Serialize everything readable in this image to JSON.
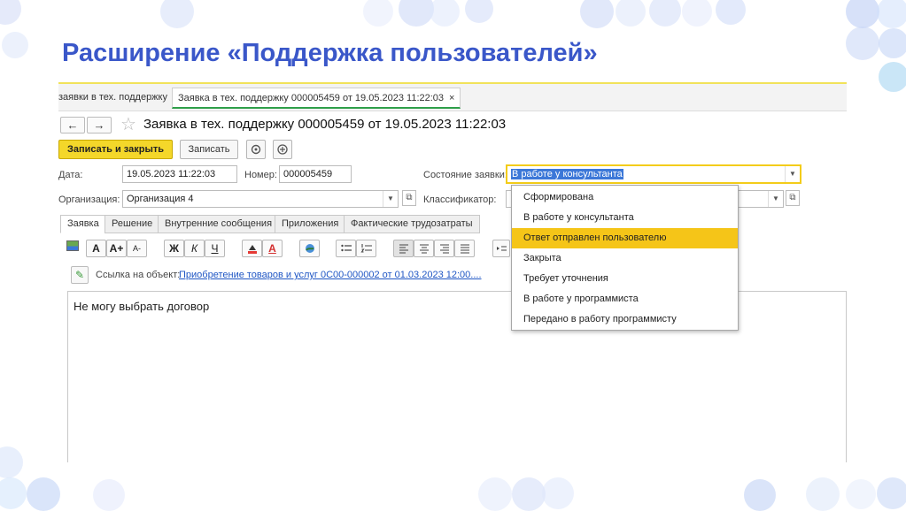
{
  "slide": {
    "title": "Расширение «Поддержка пользователей»"
  },
  "window": {
    "tabs": [
      {
        "label": "заявки в тех. поддержку",
        "close": "×"
      },
      {
        "label": "Заявка в тех. поддержку 000005459 от 19.05.2023 11:22:03",
        "close": "×"
      }
    ],
    "nav_back": "←",
    "nav_forward": "→",
    "star": "☆",
    "doc_title": "Заявка в тех. поддержку 000005459 от 19.05.2023 11:22:03"
  },
  "toolbar": {
    "save_close": "Записать и закрыть",
    "save": "Записать"
  },
  "form": {
    "date_label": "Дата:",
    "date_value": "19.05.2023 11:22:03",
    "number_label": "Номер:",
    "number_value": "000005459",
    "status_label": "Состояние заявки:",
    "status_value": "В работе у консультанта",
    "org_label": "Организация:",
    "org_value": "Организация 4",
    "classifier_label": "Классификатор:"
  },
  "form_tabs": [
    "Заявка",
    "Решение",
    "Внутренние сообщения",
    "Приложения",
    "Фактические трудозатраты"
  ],
  "format_toolbar": {
    "font_a": "А",
    "font_a_plus": "А+",
    "font_a_minus": "А-",
    "bold": "Ж",
    "italic": "К",
    "underline": "Ч",
    "color": "А"
  },
  "link": {
    "label": "Ссылка на объект:",
    "value": "Приобретение товаров и услуг 0С00-000002 от 01.03.2023 12:00...."
  },
  "editor_text": "Не могу выбрать договор",
  "status_options": [
    "Сформирована",
    "В работе у консультанта",
    "Ответ отправлен пользователю",
    "Закрыта",
    "Требует уточнения",
    "В работе у программиста",
    "Передано в работу программисту"
  ],
  "colors": {
    "accent_title": "#3a57c9",
    "highlight": "#f5c518",
    "selection": "#3c78d8"
  }
}
